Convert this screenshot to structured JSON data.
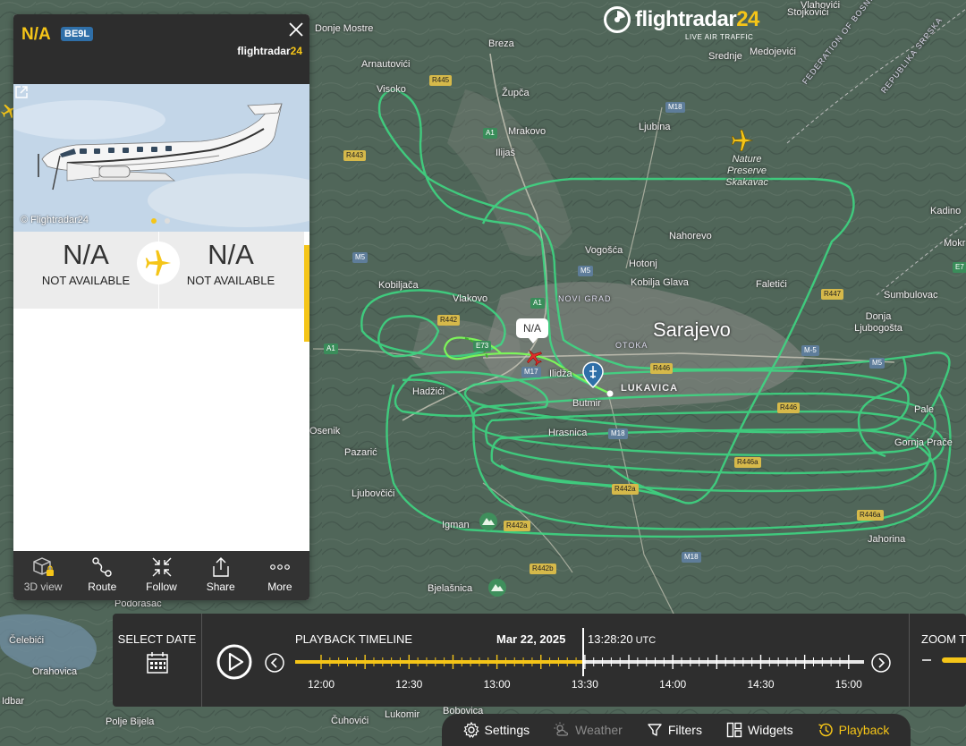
{
  "brand": {
    "name_white": "flightradar",
    "name_yellow": "24",
    "sub": "LIVE AIR TRAFFIC"
  },
  "panel": {
    "callsign": "N/A",
    "aircraft_type": "BE9L",
    "brand_white": "flightradar",
    "brand_yellow": "24",
    "photo_credit": "© Flightradar24",
    "origin": {
      "code": "N/A",
      "name": "NOT AVAILABLE"
    },
    "destination": {
      "code": "N/A",
      "name": "NOT AVAILABLE"
    },
    "toolbar": [
      {
        "label": "3D view",
        "icon": "cube-lock-icon"
      },
      {
        "label": "Route",
        "icon": "route-icon"
      },
      {
        "label": "Follow",
        "icon": "follow-icon"
      },
      {
        "label": "Share",
        "icon": "share-icon"
      },
      {
        "label": "More",
        "icon": "more-dots-icon"
      }
    ]
  },
  "map": {
    "aircraft_label": "N/A",
    "places": [
      {
        "name": "Sarajevo",
        "style": "big"
      },
      {
        "name": "LUKAVICA",
        "style": "bold"
      },
      {
        "name": "NOVI GRAD",
        "style": "caps"
      },
      {
        "name": "OTOKA",
        "style": "caps"
      },
      {
        "name": "Nature Preserve Skakavac",
        "style": "ital"
      },
      {
        "name": "FEDERATION OF BOSNIA AND",
        "style": "caps"
      },
      {
        "name": "REPUBLIKA SRPSKA",
        "style": "caps"
      },
      {
        "name": "Donje Mostre"
      },
      {
        "name": "Breza"
      },
      {
        "name": "Arnautovići"
      },
      {
        "name": "Visoko"
      },
      {
        "name": "Župča"
      },
      {
        "name": "Srednje"
      },
      {
        "name": "Medojevići"
      },
      {
        "name": "Ljubina"
      },
      {
        "name": "Mrakovo"
      },
      {
        "name": "Ilijaš"
      },
      {
        "name": "Kadino"
      },
      {
        "name": "Nahorevo"
      },
      {
        "name": "Vogošća"
      },
      {
        "name": "Hotonj"
      },
      {
        "name": "Kobilja Glava"
      },
      {
        "name": "Faletići"
      },
      {
        "name": "Kobiljača"
      },
      {
        "name": "Vlakovo"
      },
      {
        "name": "Sumbulovac"
      },
      {
        "name": "Donja Ljubogošta"
      },
      {
        "name": "Ilidža"
      },
      {
        "name": "Butmir"
      },
      {
        "name": "Hadžići"
      },
      {
        "name": "Hrasnica"
      },
      {
        "name": "Osenik"
      },
      {
        "name": "Pazarić"
      },
      {
        "name": "Ljubovčići"
      },
      {
        "name": "Igman"
      },
      {
        "name": "Bjelašnica"
      },
      {
        "name": "Jahorina"
      },
      {
        "name": "Gornja Prače"
      },
      {
        "name": "Pale"
      },
      {
        "name": "Podorasac"
      },
      {
        "name": "Čelebići"
      },
      {
        "name": "Orahovica"
      },
      {
        "name": "Polje Bijela"
      },
      {
        "name": "Čuhovići"
      },
      {
        "name": "Lukomir"
      },
      {
        "name": "Bobovica"
      },
      {
        "name": "Idbar"
      },
      {
        "name": "Mokr"
      },
      {
        "name": "Stojkovići"
      },
      {
        "name": "Vlahovići"
      }
    ],
    "roads": [
      "R445",
      "A1",
      "M18",
      "R443",
      "M5",
      "A1",
      "M5",
      "R447",
      "R442",
      "M17",
      "R446",
      "M-5",
      "M5",
      "E73",
      "R446",
      "M18",
      "R446a",
      "R442a",
      "R442a",
      "R446a",
      "M18",
      "R442b",
      "E7",
      "A1"
    ]
  },
  "playback": {
    "select_date": "SELECT DATE",
    "title": "PLAYBACK TIMELINE",
    "date": "Mar 22, 2025",
    "time": "13:28:20",
    "tz": "UTC",
    "progress": 0.506,
    "ticks": [
      "12:00",
      "12:30",
      "13:00",
      "13:30",
      "14:00",
      "14:30",
      "15:00"
    ],
    "zoom_label": "ZOOM T"
  },
  "bottom_bar": [
    {
      "label": "Settings",
      "icon": "gear-icon",
      "state": "normal"
    },
    {
      "label": "Weather",
      "icon": "weather-icon",
      "state": "disabled"
    },
    {
      "label": "Filters",
      "icon": "filter-icon",
      "state": "normal"
    },
    {
      "label": "Widgets",
      "icon": "widgets-icon",
      "state": "normal"
    },
    {
      "label": "Playback",
      "icon": "history-icon",
      "state": "active"
    }
  ],
  "colors": {
    "accent": "#f5c518",
    "track_green": "#3ddc84",
    "panel_dark": "#2d2d2d",
    "badge": "#2f6fa8"
  }
}
